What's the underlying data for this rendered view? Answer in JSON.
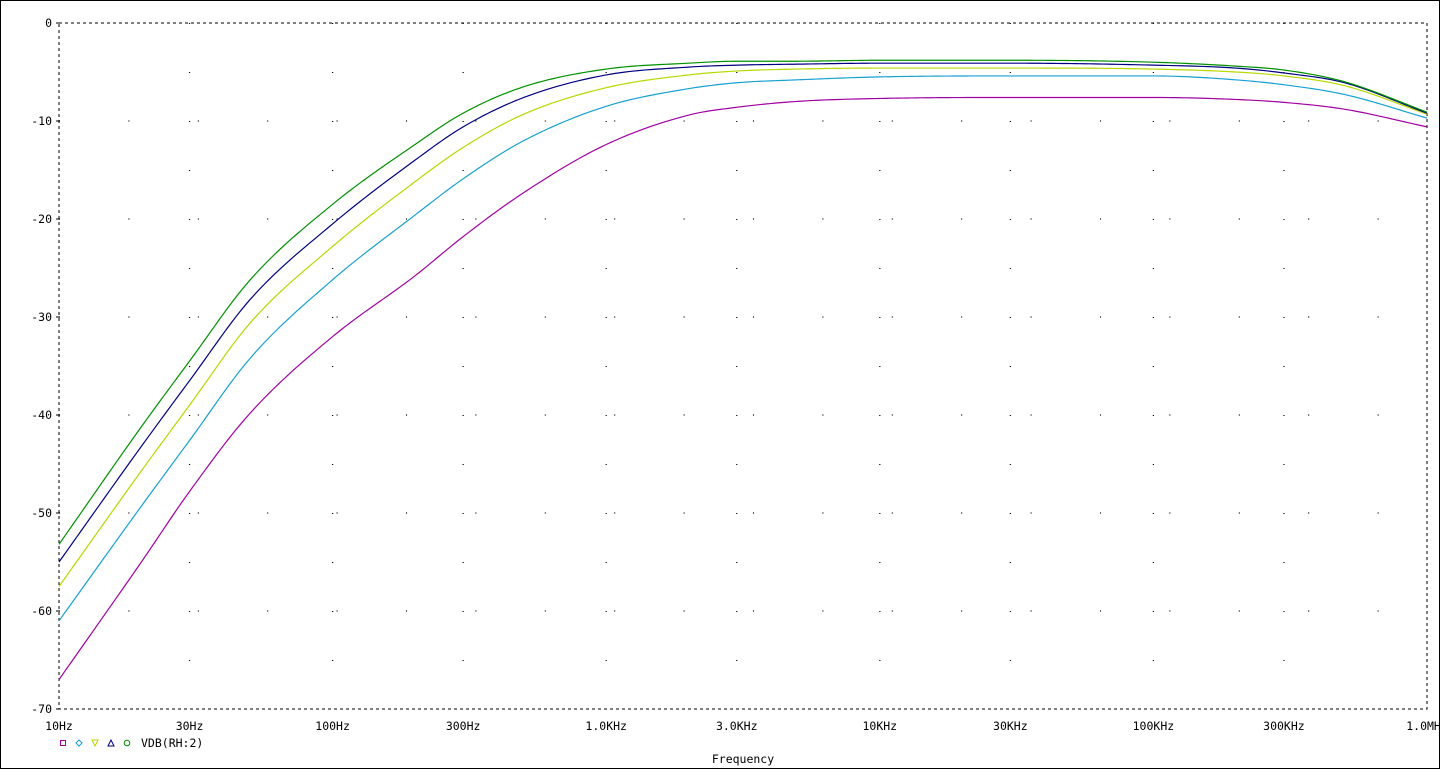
{
  "chart_data": {
    "type": "line",
    "title": "",
    "xlabel": "Frequency",
    "ylabel": "",
    "x_scale": "log",
    "xlim": [
      10,
      1000000
    ],
    "ylim": [
      -70,
      0
    ],
    "grid": "dotted",
    "x_ticks": [
      {
        "value": 10,
        "label": "10Hz"
      },
      {
        "value": 30,
        "label": "30Hz"
      },
      {
        "value": 100,
        "label": "100Hz"
      },
      {
        "value": 300,
        "label": "300Hz"
      },
      {
        "value": 1000,
        "label": "1.0KHz"
      },
      {
        "value": 3000,
        "label": "3.0KHz"
      },
      {
        "value": 10000,
        "label": "10KHz"
      },
      {
        "value": 30000,
        "label": "30KHz"
      },
      {
        "value": 100000,
        "label": "100KHz"
      },
      {
        "value": 300000,
        "label": "300KHz"
      },
      {
        "value": 1000000,
        "label": "1.0MHz"
      }
    ],
    "y_ticks": [
      {
        "value": 0,
        "label": "0"
      },
      {
        "value": -10,
        "label": "-10"
      },
      {
        "value": -20,
        "label": "-20"
      },
      {
        "value": -30,
        "label": "-30"
      },
      {
        "value": -40,
        "label": "-40"
      },
      {
        "value": -50,
        "label": "-50"
      },
      {
        "value": -60,
        "label": "-60"
      },
      {
        "value": -70,
        "label": "-70"
      }
    ],
    "legend": {
      "label": "VDB(RH:2)",
      "markers": [
        {
          "shape": "square",
          "color": "#a000a0"
        },
        {
          "shape": "diamond",
          "color": "#18a0d0"
        },
        {
          "shape": "triangle-down",
          "color": "#b8d800"
        },
        {
          "shape": "triangle-up",
          "color": "#000080"
        },
        {
          "shape": "circle",
          "color": "#009000"
        }
      ],
      "placement": "bottom-left"
    },
    "x": [
      10,
      20,
      30,
      50,
      100,
      200,
      300,
      500,
      1000,
      2000,
      3000,
      5000,
      10000,
      30000,
      100000,
      200000,
      300000,
      500000,
      1000000
    ],
    "series": [
      {
        "color": "#a000a0",
        "values": [
          -67.0,
          -55.0,
          -47.8,
          -39.8,
          -32.0,
          -25.8,
          -21.8,
          -17.3,
          -12.4,
          -9.4,
          -8.6,
          -8.0,
          -7.7,
          -7.6,
          -7.6,
          -7.8,
          -8.1,
          -8.8,
          -10.6
        ]
      },
      {
        "color": "#18a0d0",
        "values": [
          -61.0,
          -49.3,
          -42.6,
          -34.2,
          -26.2,
          -19.6,
          -15.9,
          -12.0,
          -8.5,
          -6.7,
          -6.1,
          -5.8,
          -5.5,
          -5.4,
          -5.4,
          -5.8,
          -6.3,
          -7.3,
          -9.7
        ]
      },
      {
        "color": "#b8d800",
        "values": [
          -57.5,
          -45.7,
          -39.0,
          -30.6,
          -22.8,
          -16.2,
          -12.7,
          -9.3,
          -6.6,
          -5.3,
          -4.9,
          -4.7,
          -4.6,
          -4.6,
          -4.7,
          -5.0,
          -5.4,
          -6.4,
          -9.3
        ]
      },
      {
        "color": "#000080",
        "values": [
          -55.0,
          -43.2,
          -36.5,
          -28.2,
          -20.5,
          -14.0,
          -10.6,
          -7.6,
          -5.3,
          -4.5,
          -4.3,
          -4.2,
          -4.1,
          -4.1,
          -4.3,
          -4.6,
          -5.1,
          -6.1,
          -9.2
        ]
      },
      {
        "color": "#009000",
        "values": [
          -53.2,
          -41.2,
          -34.5,
          -26.2,
          -18.5,
          -12.4,
          -9.2,
          -6.5,
          -4.7,
          -4.1,
          -3.9,
          -3.9,
          -3.8,
          -3.8,
          -4.0,
          -4.4,
          -4.8,
          -6.0,
          -9.1
        ]
      }
    ]
  }
}
